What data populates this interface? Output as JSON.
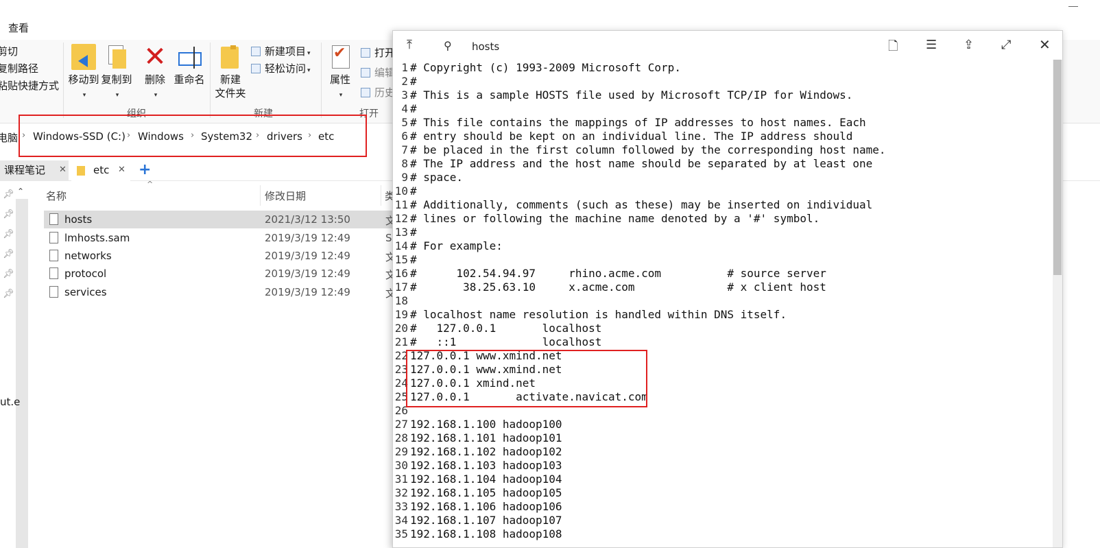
{
  "explorer": {
    "menu_view": "查看",
    "ribbon": {
      "clipboard": {
        "cut": "剪切",
        "copy_path": "复制路径",
        "paste_shortcut": "粘贴快捷方式"
      },
      "organize": {
        "move_to": "移动到",
        "copy_to": "复制到",
        "delete": "删除",
        "rename": "重命名",
        "group_label": "组织"
      },
      "new": {
        "new_folder_line1": "新建",
        "new_folder_line2": "文件夹",
        "new_item": "新建项目",
        "easy_access": "轻松访问",
        "group_label": "新建"
      },
      "open": {
        "properties": "属性",
        "open": "打开",
        "edit": "编辑",
        "history": "历史",
        "group_label": "打开"
      }
    },
    "address": {
      "root": "电脑",
      "crumbs": [
        "Windows-SSD (C:)",
        "Windows",
        "System32",
        "drivers",
        "etc"
      ]
    },
    "tabs": [
      {
        "label": "课程笔记"
      },
      {
        "label": "etc"
      }
    ],
    "nav_partial_text": "ut.e",
    "columns": {
      "name": "名称",
      "modified": "修改日期",
      "type": "类"
    },
    "files": [
      {
        "name": "hosts",
        "modified": "2021/3/12 13:50",
        "type": "文"
      },
      {
        "name": "lmhosts.sam",
        "modified": "2019/3/19 12:49",
        "type": "S"
      },
      {
        "name": "networks",
        "modified": "2019/3/19 12:49",
        "type": "文"
      },
      {
        "name": "protocol",
        "modified": "2019/3/19 12:49",
        "type": "文"
      },
      {
        "name": "services",
        "modified": "2019/3/19 12:49",
        "type": "文"
      }
    ]
  },
  "viewer": {
    "title": "hosts",
    "lines": [
      {
        "n": "1",
        "t": "# Copyright (c) 1993-2009 Microsoft Corp."
      },
      {
        "n": "2",
        "t": "#"
      },
      {
        "n": "3",
        "t": "# This is a sample HOSTS file used by Microsoft TCP/IP for Windows."
      },
      {
        "n": "4",
        "t": "#"
      },
      {
        "n": "5",
        "t": "# This file contains the mappings of IP addresses to host names. Each"
      },
      {
        "n": "6",
        "t": "# entry should be kept on an individual line. The IP address should"
      },
      {
        "n": "7",
        "t": "# be placed in the first column followed by the corresponding host name."
      },
      {
        "n": "8",
        "t": "# The IP address and the host name should be separated by at least one"
      },
      {
        "n": "9",
        "t": "# space."
      },
      {
        "n": "10",
        "t": "#"
      },
      {
        "n": "11",
        "t": "# Additionally, comments (such as these) may be inserted on individual"
      },
      {
        "n": "12",
        "t": "# lines or following the machine name denoted by a '#' symbol."
      },
      {
        "n": "13",
        "t": "#"
      },
      {
        "n": "14",
        "t": "# For example:"
      },
      {
        "n": "15",
        "t": "#"
      },
      {
        "n": "16",
        "t": "#      102.54.94.97     rhino.acme.com          # source server"
      },
      {
        "n": "17",
        "t": "#       38.25.63.10     x.acme.com              # x client host"
      },
      {
        "n": "18",
        "t": ""
      },
      {
        "n": "19",
        "t": "# localhost name resolution is handled within DNS itself."
      },
      {
        "n": "20",
        "t": "#   127.0.0.1       localhost"
      },
      {
        "n": "21",
        "t": "#   ::1             localhost"
      },
      {
        "n": "22",
        "t": "127.0.0.1 www.xmind.net"
      },
      {
        "n": "23",
        "t": "127.0.0.1 www.xmind.net"
      },
      {
        "n": "24",
        "t": "127.0.0.1 xmind.net"
      },
      {
        "n": "25",
        "t": "127.0.0.1       activate.navicat.com"
      },
      {
        "n": "26",
        "t": ""
      },
      {
        "n": "27",
        "t": "192.168.1.100 hadoop100"
      },
      {
        "n": "28",
        "t": "192.168.1.101 hadoop101"
      },
      {
        "n": "29",
        "t": "192.168.1.102 hadoop102"
      },
      {
        "n": "30",
        "t": "192.168.1.103 hadoop103"
      },
      {
        "n": "31",
        "t": "192.168.1.104 hadoop104"
      },
      {
        "n": "32",
        "t": "192.168.1.105 hadoop105"
      },
      {
        "n": "33",
        "t": "192.168.1.106 hadoop106"
      },
      {
        "n": "34",
        "t": "192.168.1.107 hadoop107"
      },
      {
        "n": "35",
        "t": "192.168.1.108 hadoop108"
      }
    ]
  },
  "colors": {
    "highlight": "#e02020",
    "accent": "#2a74d6",
    "selection": "#dcdcdc"
  },
  "icons": [
    "pin-top-icon",
    "pin-icon",
    "document-icon",
    "list-icon",
    "share-icon",
    "expand-icon",
    "close-icon"
  ]
}
